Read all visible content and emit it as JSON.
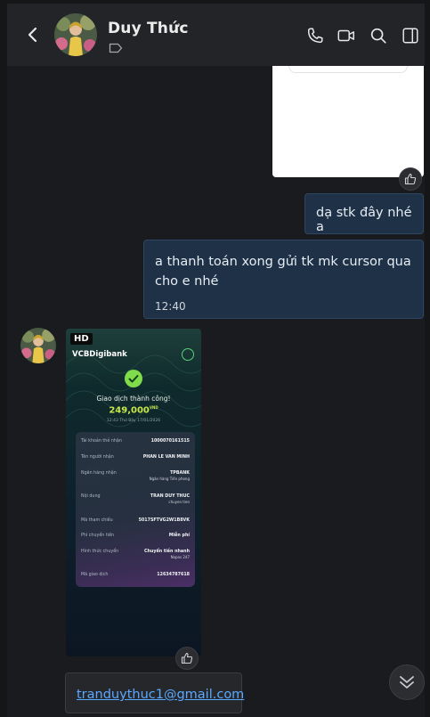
{
  "header": {
    "contact_name": "Duy Thức",
    "icons": [
      "back-arrow-icon",
      "tag-icon",
      "phone-icon",
      "video-icon",
      "search-icon",
      "sidebar-toggle-icon"
    ]
  },
  "messages": {
    "outgoing_1": "dạ stk đây nhé a",
    "outgoing_2": "a thanh toán xong gửi tk mk cursor qua cho e nhé",
    "outgoing_2_time": "12:40",
    "email_link": "tranduythuc1@gmail.com"
  },
  "receipt": {
    "badge": "HD",
    "bank_logo": "VCB",
    "bank_logo_suffix": "Digibank",
    "status": "Giao dịch thành công!",
    "amount": "249,000",
    "currency": "VND",
    "datetime": "12:43 Thứ Bảy 17/01/2026",
    "rows": [
      {
        "label": "Tài khoản thẻ nhận",
        "value": "1000070161515"
      },
      {
        "label": "Tên người nhận",
        "value": "PHAN LE VAN MINH"
      },
      {
        "label": "Ngân hàng nhận",
        "value": "TPBANK",
        "sub": "Ngân hàng Tiên phong"
      },
      {
        "label": "Nội dung",
        "value": "TRAN DUY THUC",
        "sub": "chuyen tien"
      },
      {
        "label": "Mã tham chiếu",
        "value": "5017SFTVG2W1B8VK"
      },
      {
        "label": "Phí chuyển tiền",
        "value": "Miễn phí"
      },
      {
        "label": "Hình thức chuyển",
        "value": "Chuyển tiền nhanh",
        "sub": "Napas 247"
      },
      {
        "label": "Mã giao dịch",
        "value": "12634787618"
      }
    ]
  },
  "colors": {
    "bubble_outgoing": "#1f3147",
    "link": "#5aa8ff",
    "background": "#1a1b1e",
    "header": "#232428"
  }
}
